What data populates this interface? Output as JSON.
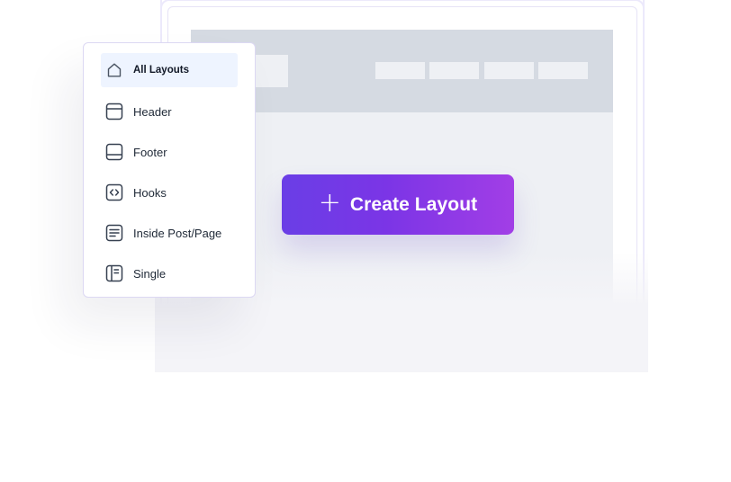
{
  "create_button": {
    "icon": "plus-icon",
    "label": "Create Layout",
    "gradient_start": "#6a3ee6",
    "gradient_end": "#a23ee6"
  },
  "menu": {
    "items": [
      {
        "label": "All Layouts",
        "icon": "home-icon",
        "active": true
      },
      {
        "label": "Header",
        "icon": "header-layout-icon",
        "active": false
      },
      {
        "label": "Footer",
        "icon": "footer-layout-icon",
        "active": false
      },
      {
        "label": "Hooks",
        "icon": "code-icon",
        "active": false
      },
      {
        "label": "Inside Post/Page",
        "icon": "document-lines-icon",
        "active": false
      },
      {
        "label": "Single",
        "icon": "single-layout-icon",
        "active": false
      }
    ]
  },
  "colors": {
    "active_item_bg": "#eef4ff",
    "menu_border": "#dcd8f3",
    "site_header": "#d5dae2",
    "site_body": "#eef0f4"
  }
}
